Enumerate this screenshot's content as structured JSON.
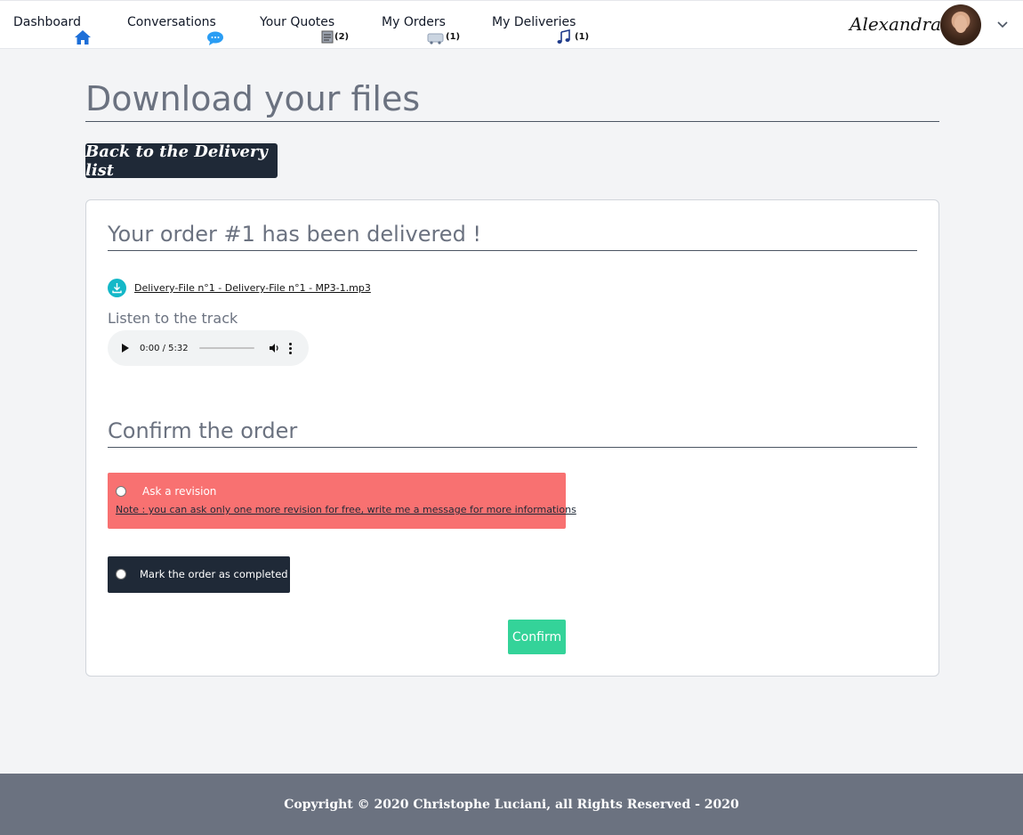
{
  "nav": {
    "items": [
      {
        "label": "Dashboard",
        "icon": "home-icon",
        "badge": ""
      },
      {
        "label": "Conversations",
        "icon": "chat-bubble-icon",
        "badge": ""
      },
      {
        "label": "Your Quotes",
        "icon": "quote-document-icon",
        "badge": "(2)"
      },
      {
        "label": "My Orders",
        "icon": "cart-icon",
        "badge": "(1)"
      },
      {
        "label": "My Deliveries",
        "icon": "music-note-icon",
        "badge": "(1)"
      }
    ],
    "user_name": "Alexandra"
  },
  "page": {
    "title": "Download your files",
    "back_button": "Back to the Delivery list"
  },
  "order": {
    "heading": "Your order #1 has been delivered !",
    "file_name": "Delivery-File n°1 - Delivery-File n°1 - MP3-1.mp3",
    "listen_label": "Listen to the track",
    "audio_time": "0:00 / 5:32"
  },
  "confirm": {
    "heading": "Confirm the order",
    "revision_label": "Ask a revision",
    "revision_note": "Note : you can ask only one more revision for free, write me a message for more informations",
    "complete_label": "Mark the order as completed !",
    "confirm_button": "Confirm"
  },
  "footer": {
    "text": "Copyright © 2020 Christophe Luciani, all Rights Reserved - 2020"
  },
  "colors": {
    "dark": "#1f2937",
    "revision": "#f87171",
    "confirm": "#34d399",
    "download": "#14b8c8",
    "footer": "#6b7280"
  }
}
